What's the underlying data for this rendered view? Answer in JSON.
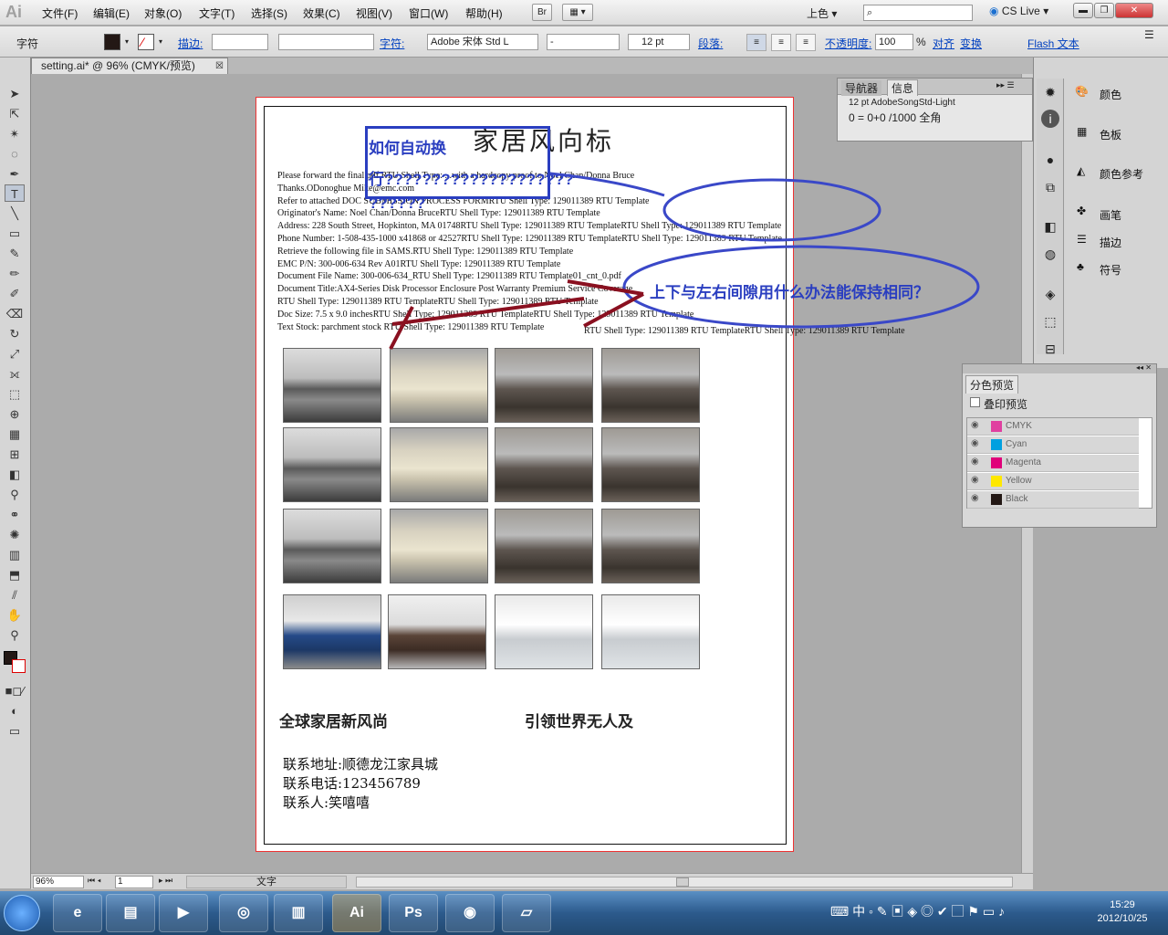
{
  "app": {
    "logo": "Ai"
  },
  "menu": [
    "文件(F)",
    "编辑(E)",
    "对象(O)",
    "文字(T)",
    "选择(S)",
    "效果(C)",
    "视图(V)",
    "窗口(W)",
    "帮助(H)"
  ],
  "menubar": {
    "bridge": "Br",
    "workspace": "上色",
    "cslive": "CS Live"
  },
  "control_bar": {
    "label": "字符",
    "stroke_label": "描边:",
    "char_label": "字符:",
    "font_family": "Adobe 宋体 Std L",
    "font_style": "-",
    "font_size": "12 pt",
    "paragraph_label": "段落:",
    "opacity_label": "不透明度:",
    "opacity_value": "100",
    "opacity_unit": "%",
    "align_label": "对齐",
    "transform_label": "变换",
    "flash_label": "Flash 文本"
  },
  "document": {
    "tab_title": "setting.ai* @ 96% (CMYK/预览)"
  },
  "artwork": {
    "title": "家居风向标",
    "lines": [
      "Please forward the final          pdf           RTU Shell Type:   ...with a hardcopy proof to Noel Chan/Donna Bruce",
      "Thanks.ODonoghue  Mike@emc.com",
      "Refer to attached DOC        SUBMISSION PROCESS FORMRTU Shell Type:  129011389 RTU Template",
      "Originator's Name: Noel Chan/Donna BruceRTU Shell Type:  129011389 RTU Template",
      "Address: 228 South Street, Hopkinton, MA   01748RTU Shell Type:  129011389 RTU TemplateRTU Shell Type:  129011389 RTU Template",
      "Phone Number:   1-508-435-1000  x41868 or 42527RTU Shell Type:  129011389 RTU TemplateRTU Shell Type:  129011389 RTU Template",
      "Retrieve the following file in SAMS.RTU Shell Type:  129011389 RTU Template",
      "EMC P/N: 300-006-634 Rev A01RTU Shell Type:  129011389 RTU Template",
      "Document File Name: 300-006-634_RTU Shell Type:  129011389 RTU Template01_cnt_0.pdf",
      "Document Title:AX4-Series Disk Processor Enclosure Post Warranty Premium Service Coverage",
      "RTU Shell Type:  129011389 RTU TemplateRTU Shell Type:  129011389 RTU Template",
      "Doc Size: 7.5 x 9.0 inchesRTU Shell Type:  129011389 RTU TemplateRTU Shell Type:  129011389 RTU Template",
      "Text Stock:  parchment stock  RTU Shell Type:  129011389 RTU Template"
    ],
    "overflow_line": "RTU Shell Type:  129011389 RTU TemplateRTU Shell Type:  129011389 RTU Template",
    "slogan_left": "全球家居新风尚",
    "slogan_right": "引领世界无人及",
    "contact_address": "联系地址:顺德龙江家具城",
    "contact_phone": "联系电话:123456789",
    "contact_person": "联系人:笑嘻嘻"
  },
  "annotations": {
    "question_1_line1": "如何自动换",
    "question_1_line2": "行????????????????????",
    "question_1_line3": "??????",
    "question_2": "上下与左右间隙用什么办法能保持相同？"
  },
  "panels": {
    "nav_tabs": [
      "导航器",
      "信息"
    ],
    "info_font": "12 pt AdobeSongStd-Light",
    "info_value": "0 = 0+0 /1000 全角",
    "right_items": [
      "颜色",
      "色板",
      "颜色参考",
      "画笔",
      "描边",
      "符号"
    ],
    "separations": {
      "title": "分色预览",
      "overprint": "叠印预览",
      "rows": [
        {
          "name": "CMYK",
          "color": "#e03fa0"
        },
        {
          "name": "Cyan",
          "color": "#00a0e0"
        },
        {
          "name": "Magenta",
          "color": "#e0007a"
        },
        {
          "name": "Yellow",
          "color": "#ffe800"
        },
        {
          "name": "Black",
          "color": "#231815"
        }
      ]
    }
  },
  "status": {
    "zoom": "96%",
    "page": "1",
    "tool": "文字"
  },
  "taskbar": {
    "time": "15:29",
    "date": "2012/10/25",
    "ime": "中"
  },
  "colors": {
    "annotation_blue": "#2a3ec0",
    "arrow_red": "#8a1020",
    "artboard_bleed": "#e33333"
  }
}
